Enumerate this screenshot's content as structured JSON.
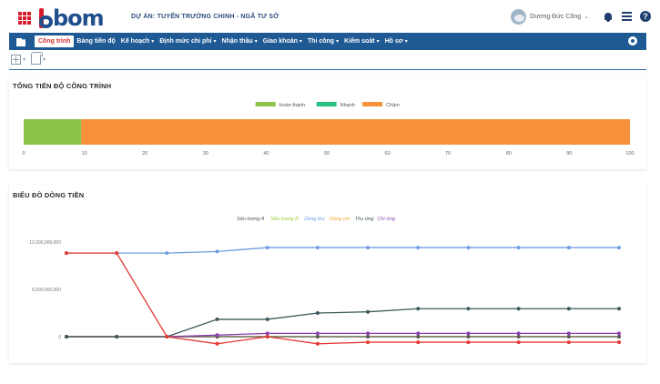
{
  "header": {
    "project_title": "DỰ ÁN: TUYẾN TRƯỜNG CHINH - NGÃ TƯ SỞ",
    "logo_text": "bom",
    "user_name": "Dương Đức Công",
    "user_caret": "⌄"
  },
  "icons": {
    "apps": "apps-grid-icon",
    "home": "folder-icon",
    "bell": "bell-icon",
    "list": "list-icon",
    "help": "help-icon",
    "gear": "gear-icon"
  },
  "colors": {
    "brand_red": "#d81b2c",
    "brand_blue": "#1f4e8c",
    "menu_bg": "#1f5a95",
    "hoan_thanh": "#8bc34a",
    "nhanh": "#26c281",
    "cham": "#f7923a"
  },
  "menu": {
    "items": [
      {
        "label": "Công trình",
        "active": true,
        "has_caret": false
      },
      {
        "label": "Bảng tiến độ",
        "active": false,
        "has_caret": false
      },
      {
        "label": "Kế hoạch",
        "active": false,
        "has_caret": true
      },
      {
        "label": "Định mức chi phí",
        "active": false,
        "has_caret": true
      },
      {
        "label": "Nhận thầu",
        "active": false,
        "has_caret": true
      },
      {
        "label": "Giao khoán",
        "active": false,
        "has_caret": true
      },
      {
        "label": "Thi công",
        "active": false,
        "has_caret": true
      },
      {
        "label": "Kiểm soát",
        "active": false,
        "has_caret": true
      },
      {
        "label": "Hồ sơ",
        "active": false,
        "has_caret": true
      }
    ],
    "caret": "▾"
  },
  "toolbar": {
    "caret": "▾"
  },
  "progress_panel": {
    "title": "TỔNG TIẾN ĐỘ CÔNG TRÌNH"
  },
  "cashflow_panel": {
    "title": "BIỂU ĐỒ DÒNG TIỀN"
  },
  "chart_data": [
    {
      "type": "bar",
      "orientation": "horizontal",
      "stacked": true,
      "series": [
        {
          "name": "Hoàn thành",
          "color": "#8bc34a",
          "values": [
            9.5
          ]
        },
        {
          "name": "Nhanh",
          "color": "#26c281",
          "values": [
            0
          ]
        },
        {
          "name": "Chậm",
          "color": "#f7923a",
          "values": [
            90.5
          ]
        }
      ],
      "xlim": [
        0,
        100
      ],
      "x_ticks": [
        "0",
        "10",
        "20",
        "30",
        "40",
        "50",
        "60",
        "70",
        "80",
        "90",
        "100"
      ],
      "legend_position": "top-center",
      "grid": false
    },
    {
      "type": "line",
      "x": [
        1,
        2,
        3,
        4,
        5,
        6,
        7,
        8,
        9,
        10,
        11,
        12
      ],
      "series": [
        {
          "name": "Sản lượng A",
          "color": "#5a5a5a",
          "values": [
            0,
            0,
            0,
            0,
            0,
            0,
            0,
            0,
            0,
            0,
            0,
            0
          ]
        },
        {
          "name": "Sản lượng B",
          "color": "#9acd32",
          "values": [
            0,
            0,
            0,
            0,
            0,
            0,
            0,
            0,
            0,
            0,
            0,
            0
          ]
        },
        {
          "name": "Dòng thu",
          "color": "#6f9ee0",
          "values": [
            10600000000,
            10600000000,
            10600000000,
            10800000000,
            11300000000,
            11300000000,
            11300000000,
            11300000000,
            11300000000,
            11300000000,
            11300000000,
            11300000000
          ]
        },
        {
          "name": "Dòng chi",
          "color": "#f0a030",
          "values": [
            0,
            0,
            0,
            0,
            0,
            0,
            0,
            0,
            0,
            0,
            0,
            0
          ]
        },
        {
          "name": "Thu ứng",
          "color": "#3d5a5a",
          "values": [
            0,
            0,
            0,
            2200000000,
            2200000000,
            3000000000,
            3150000000,
            3550000000,
            3550000000,
            3550000000,
            3550000000,
            3550000000
          ]
        },
        {
          "name": "Chi ứng",
          "color": "#8b3fb0",
          "values": [
            0,
            0,
            0,
            200000000,
            420000000,
            420000000,
            420000000,
            420000000,
            420000000,
            420000000,
            420000000,
            420000000
          ]
        },
        {
          "name": "",
          "color": "#e53935",
          "values": [
            10600000000,
            10600000000,
            0,
            -900000000,
            0,
            -900000000,
            -700000000,
            -700000000,
            -700000000,
            -700000000,
            -700000000,
            -700000000
          ]
        }
      ],
      "ylim": [
        -1000000000,
        12000000000
      ],
      "y_ticks": [
        {
          "value": 12000000000,
          "label": "12,000,000,000"
        },
        {
          "value": 6000000000,
          "label": "6,000,000,000"
        },
        {
          "value": 0,
          "label": "0"
        }
      ],
      "legend_position": "top-center",
      "grid": false,
      "markers": true
    }
  ]
}
